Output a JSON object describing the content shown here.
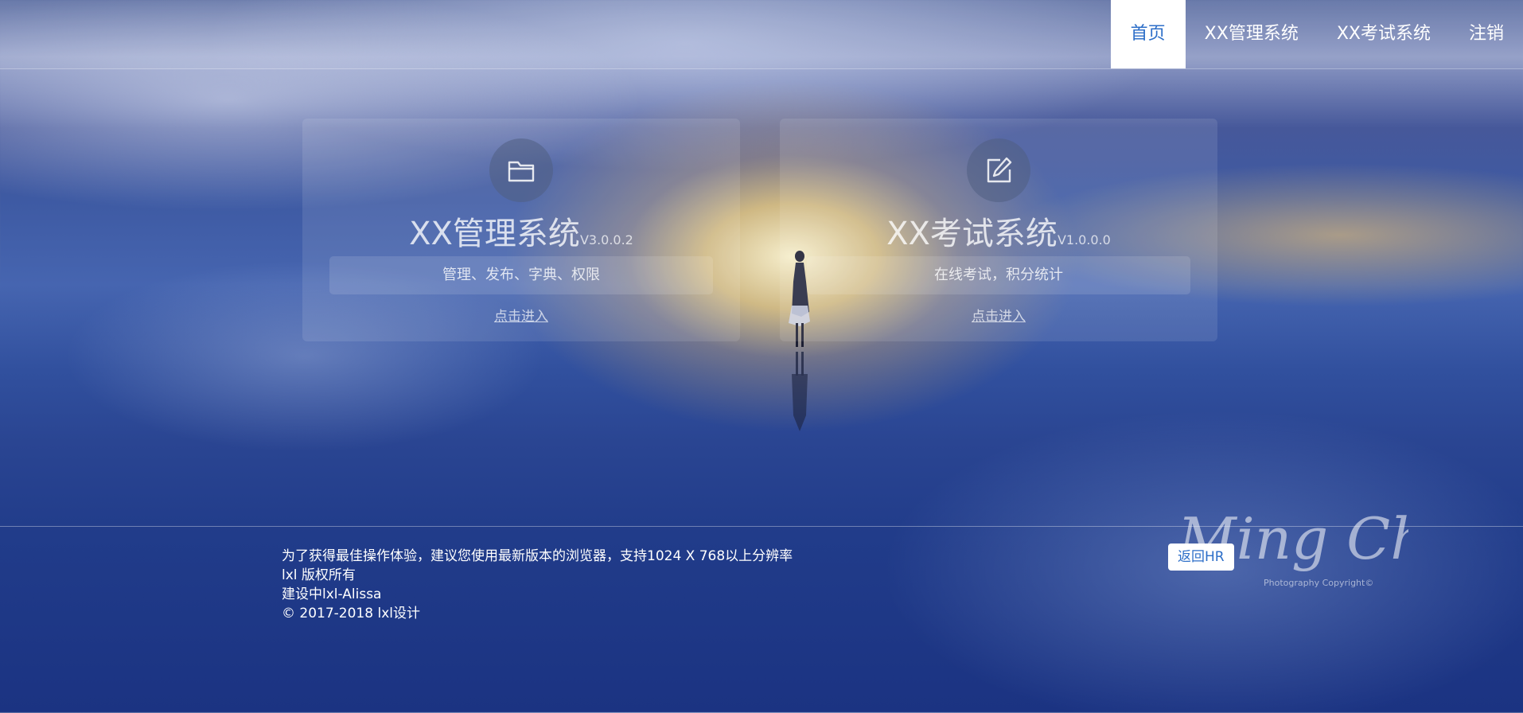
{
  "nav": {
    "items": [
      {
        "label": "首页",
        "active": true
      },
      {
        "label": "XX管理系统",
        "active": false
      },
      {
        "label": "XX考试系统",
        "active": false
      },
      {
        "label": "注销",
        "active": false
      }
    ]
  },
  "cards": [
    {
      "icon": "folder-icon",
      "name": "XX管理系统",
      "version": "V3.0.0.2",
      "description": "管理、发布、字典、权限",
      "link": "点击进入"
    },
    {
      "icon": "edit-icon",
      "name": "XX考试系统",
      "version": "V1.0.0.0",
      "description": "在线考试，积分统计",
      "link": "点击进入"
    }
  ],
  "footer": {
    "lines": [
      "为了获得最佳操作体验，建议您使用最新版本的浏览器，支持1024 X 768以上分辨率",
      "lxl 版权所有",
      "建设中lxl-Alissa",
      "© 2017-2018 lxl设计"
    ],
    "hr_button": "返回HR",
    "watermark": "Ming Chen",
    "watermark_sub": "Photography Copyright©"
  },
  "colors": {
    "accent": "#2c6ec8",
    "text": "#ffffff"
  }
}
